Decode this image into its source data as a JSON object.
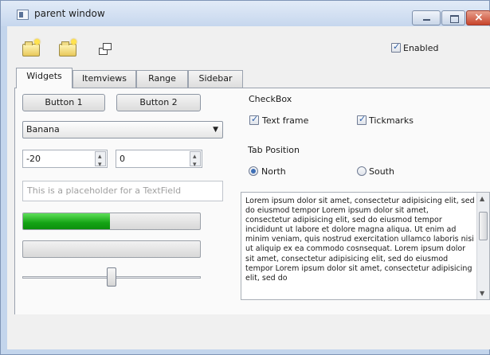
{
  "window": {
    "title": "parent window"
  },
  "toolbar": {
    "tools": [
      {
        "icon": "new-folder-icon"
      },
      {
        "icon": "open-folder-icon"
      },
      {
        "icon": "windows-icon"
      }
    ],
    "enabled": {
      "label": "Enabled",
      "checked": true
    }
  },
  "tabs": [
    {
      "label": "Widgets",
      "active": true
    },
    {
      "label": "Itemviews",
      "active": false
    },
    {
      "label": "Range",
      "active": false
    },
    {
      "label": "Sidebar",
      "active": false
    }
  ],
  "widgets": {
    "button1": "Button 1",
    "button2": "Button 2",
    "combo_value": "Banana",
    "spin1_value": "-20",
    "spin2_value": "0",
    "textfield_placeholder": "This is a placeholder for a TextField",
    "progress1_fraction": 0.49,
    "progress2_fraction": 0.0,
    "slider_fraction": 0.5
  },
  "checkbox_group": {
    "title": "CheckBox",
    "items": [
      {
        "label": "Text frame",
        "checked": true
      },
      {
        "label": "Tickmarks",
        "checked": true
      }
    ]
  },
  "tab_position": {
    "title": "Tab Position",
    "options": [
      {
        "label": "North",
        "selected": true
      },
      {
        "label": "South",
        "selected": false
      }
    ]
  },
  "textarea": {
    "text": "Lorem ipsum dolor sit amet, consectetur adipisicing elit, sed do eiusmod tempor Lorem ipsum dolor sit amet, consectetur adipisicing elit, sed do eiusmod tempor incididunt ut labore et dolore magna aliqua. Ut enim ad minim veniam, quis nostrud exercitation ullamco laboris nisi ut aliquip ex ea commodo cosnsequat. Lorem ipsum dolor sit amet, consectetur adipisicing elit, sed do eiusmod tempor Lorem ipsum dolor sit amet, consectetur adipisicing elit, sed do"
  }
}
